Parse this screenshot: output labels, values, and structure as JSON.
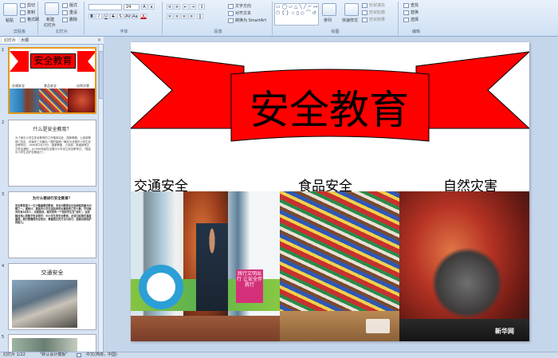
{
  "ribbon": {
    "clipboard": {
      "paste": "粘贴",
      "cut": "剪切",
      "copy": "复制",
      "format_painter": "格式刷",
      "label": "剪贴板"
    },
    "slides": {
      "new_slide": "新建",
      "new_slide2": "幻灯片",
      "layout": "版式",
      "reset": "重设",
      "delete": "删除",
      "label": "幻灯片"
    },
    "font": {
      "size": "24",
      "label": "字体"
    },
    "paragraph": {
      "text_direction": "文字方向",
      "align_text": "对齐文本",
      "smartart": "转换为 SmartArt",
      "label": "段落"
    },
    "drawing": {
      "arrange": "排列",
      "quick_styles": "快速样式",
      "shape_fill": "形状填充",
      "shape_outline": "形状轮廓",
      "shape_effects": "形状效果",
      "label": "绘图"
    },
    "editing": {
      "find": "查找",
      "replace": "替换",
      "select": "选择",
      "label": "编辑"
    }
  },
  "panel": {
    "tab_slides": "幻灯片",
    "tab_outline": "大纲",
    "close": "×"
  },
  "thumbnails": [
    {
      "num": "1",
      "title": "安全教育",
      "captions": [
        "交通安全",
        "食品安全",
        "自然灾害"
      ]
    },
    {
      "num": "2",
      "title": "什么是安全教育？",
      "body": "为了使中小学生安全教育的工作落到实处，国家教委、公安部等部门决定，将每年三月最后一周的星期一确定为全国中小学生安全教育日。1996年2月29日，国家教委、公安部、铁道部等正式发出通知，从1996年起在全国中小学设立安全教育日，\"提高中小学生自护自救能力\"。"
    },
    {
      "num": "3",
      "title": "为什么要进行安全教育？",
      "body": "安全教育是人一生中最重要的教育，安全问题是全社会面临的重大问题之一。据统计，我国中小学生因各种安全事故死亡的人数，平均每天约有40多人，也就是说，每天将有一个班的学生在\"消失\"。这些触目惊心的数字告诉我们：中小学生的安全教育，必须引起我们高度重视。我们要懂得安全知识，掌握逃生的方法与技巧，提高自我保护的能力。"
    },
    {
      "num": "4",
      "title": "交通安全"
    },
    {
      "num": "5"
    }
  ],
  "slide": {
    "title": "安全教育",
    "captions": [
      "交通安全",
      "食品安全",
      "自然灾害"
    ],
    "bus_banner": "践行文明出行 让安全伴我行",
    "watermark": "新华网"
  },
  "status": {
    "slide_count": "幻灯片 1/22",
    "theme": "\"默认设计模板\"",
    "language": "中文(简体，中国)"
  },
  "colors": {
    "banner_red": "#ff0000",
    "ribbon_bg": "#dbe7f5",
    "selection": "#e69a1c"
  }
}
